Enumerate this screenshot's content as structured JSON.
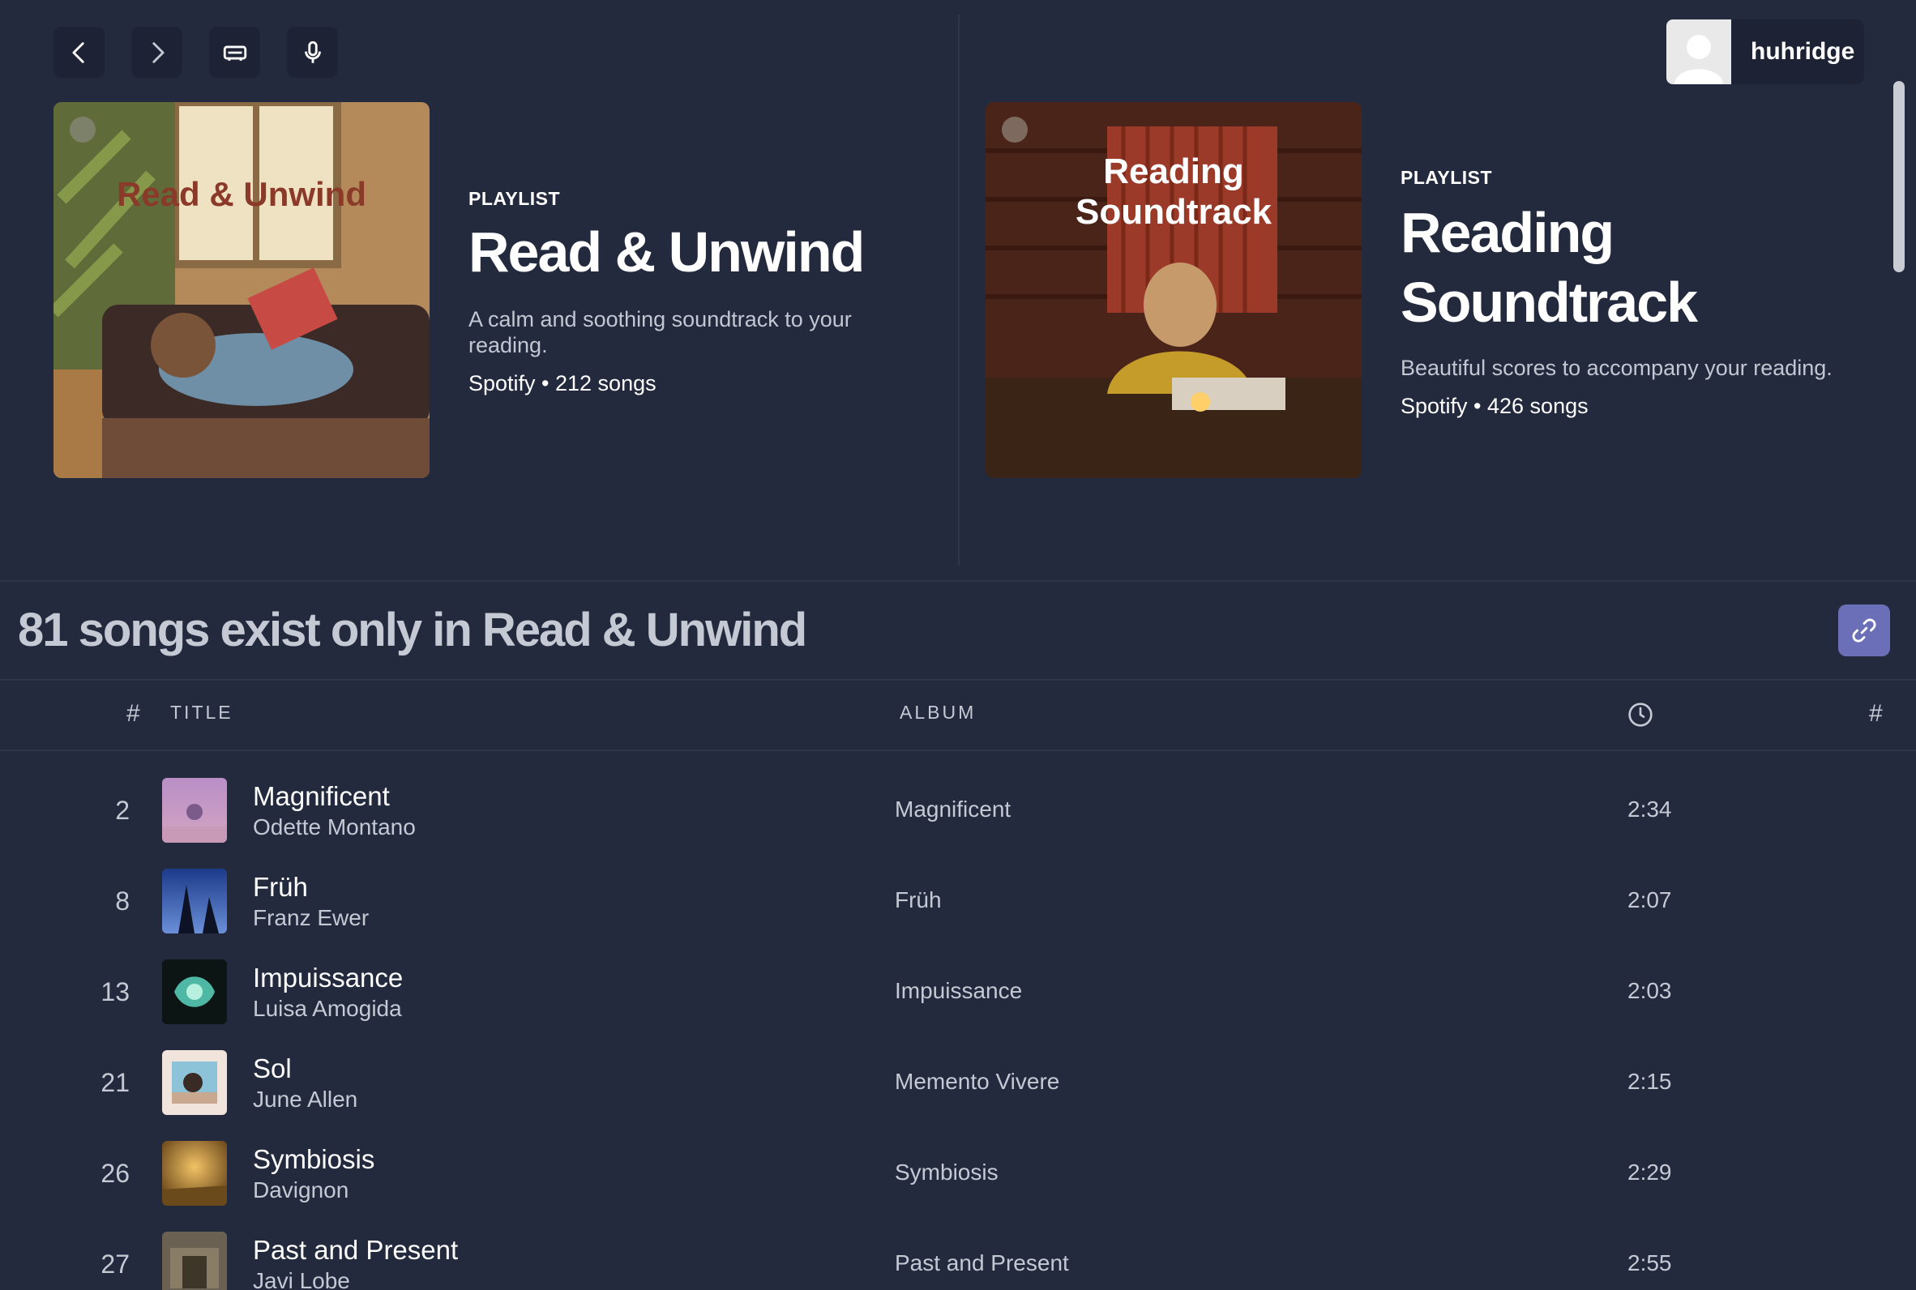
{
  "user": {
    "name": "huhridge"
  },
  "nav": {
    "back": "chevron-left-icon",
    "forward": "chevron-right-icon",
    "devices": "device-icon",
    "mic": "microphone-icon"
  },
  "playlists": [
    {
      "kicker": "PLAYLIST",
      "cover_text": "Read & Unwind",
      "title": "Read & Unwind",
      "description": "A calm and soothing soundtrack to your reading.",
      "meta": "Spotify • 212 songs"
    },
    {
      "kicker": "PLAYLIST",
      "cover_text_line1": "Reading",
      "cover_text_line2": "Soundtrack",
      "title_line1": "Reading",
      "title_line2": "Soundtrack",
      "description": "Beautiful scores to accompany your reading.",
      "meta": "Spotify • 426 songs"
    }
  ],
  "section": {
    "title": "81 songs exist only in Read & Unwind"
  },
  "columns": {
    "num": "#",
    "title": "TITLE",
    "album": "ALBUM",
    "right_num": "#"
  },
  "tracks": [
    {
      "num": "2",
      "title": "Magnificent",
      "artist": "Odette Montano",
      "album": "Magnificent",
      "duration": "2:34"
    },
    {
      "num": "8",
      "title": "Früh",
      "artist": "Franz Ewer",
      "album": "Früh",
      "duration": "2:07"
    },
    {
      "num": "13",
      "title": "Impuissance",
      "artist": "Luisa Amogida",
      "album": "Impuissance",
      "duration": "2:03"
    },
    {
      "num": "21",
      "title": "Sol",
      "artist": "June Allen",
      "album": "Memento Vivere",
      "duration": "2:15"
    },
    {
      "num": "26",
      "title": "Symbiosis",
      "artist": "Davignon",
      "album": "Symbiosis",
      "duration": "2:29"
    },
    {
      "num": "27",
      "title": "Past and Present",
      "artist": "Javi Lobe",
      "album": "Past and Present",
      "duration": "2:55"
    }
  ]
}
